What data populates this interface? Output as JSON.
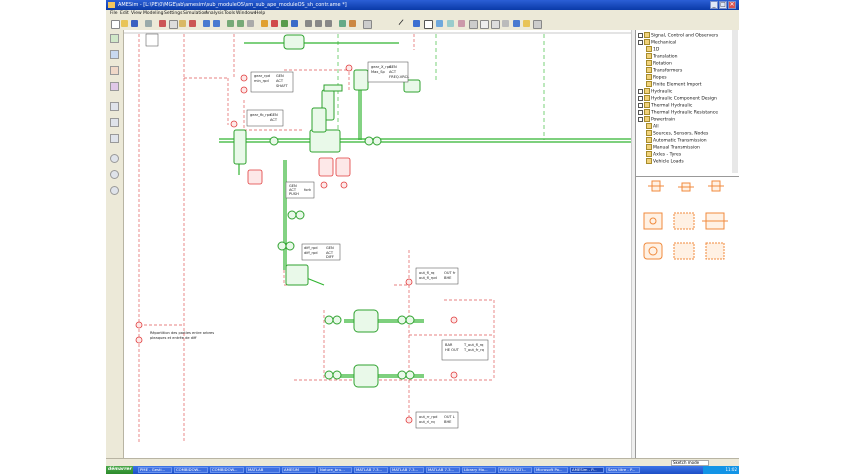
{
  "window": {
    "title": "AMESim - [L:\\PE\\0\\MGE\\ab\\amesim\\sub_moduleOS\\sm_sub_ape_moduleOS_sh_contr.ame *]",
    "controls": [
      "_",
      "□",
      "✕"
    ]
  },
  "menu": [
    "File",
    "Edit",
    "View",
    "Modeling",
    "Settings",
    "Simulation",
    "Analysis",
    "Tools",
    "Windows",
    "Help"
  ],
  "library_tree": [
    {
      "label": "Signal, Control and Observers",
      "level": 0,
      "kind": "folder"
    },
    {
      "label": "Mechanical",
      "level": 0,
      "kind": "folder"
    },
    {
      "label": "1D",
      "level": 1,
      "kind": "item"
    },
    {
      "label": "Translation",
      "level": 1,
      "kind": "item"
    },
    {
      "label": "Rotation",
      "level": 1,
      "kind": "item"
    },
    {
      "label": "Transformers",
      "level": 1,
      "kind": "item"
    },
    {
      "label": "Ropes",
      "level": 1,
      "kind": "item"
    },
    {
      "label": "Finite Element Import",
      "level": 1,
      "kind": "item"
    },
    {
      "label": "Hydraulic",
      "level": 0,
      "kind": "folder"
    },
    {
      "label": "Hydraulic Component Design",
      "level": 0,
      "kind": "folder"
    },
    {
      "label": "Thermal Hydraulic",
      "level": 0,
      "kind": "folder"
    },
    {
      "label": "Thermal Hydraulic Resistance",
      "level": 0,
      "kind": "folder"
    },
    {
      "label": "Powertrain",
      "level": 0,
      "kind": "folder"
    },
    {
      "label": "All",
      "level": 1,
      "kind": "item"
    },
    {
      "label": "Sources, Sensors, Nodes",
      "level": 1,
      "kind": "item"
    },
    {
      "label": "Automatic Transmission",
      "level": 1,
      "kind": "item"
    },
    {
      "label": "Manual Transmission",
      "level": 1,
      "kind": "item"
    },
    {
      "label": "Axles - Tyres",
      "level": 1,
      "kind": "item"
    },
    {
      "label": "Vehicle Loads",
      "level": 1,
      "kind": "item"
    }
  ],
  "diagram": {
    "labels": {
      "box1": [
        "gear_rpd",
        "min_rpd",
        "",
        "GEN",
        "ACT",
        "SHAFT"
      ],
      "box2": [
        "gear_fb_rpd",
        "",
        "GEN",
        "ACT"
      ],
      "box3": [
        "gear_X_rpd",
        "Max_Sp",
        "",
        "GEN",
        "ACT",
        "FREQ.VRCL"
      ],
      "box4": [
        "GEN",
        "ACT",
        "PUSH",
        "",
        "fork"
      ],
      "box5": [
        "diff_rpd",
        "diff_rpd",
        "",
        "GEN",
        "ACT",
        "DIFF"
      ],
      "box6": [
        "out_fl_rq",
        "out_fl_rpd",
        "",
        "OUT fr",
        "BHE"
      ],
      "box7": [
        "BAR",
        "HE OUT",
        "",
        "T_out_fl_rq",
        "T_out_fr_rq"
      ],
      "box8": [
        "out_rr_rpd",
        "out_rl_rq",
        "",
        "OUT L",
        "BHE"
      ],
      "note": [
        "Répartition des parties entre arbres",
        "pleaques et entrée de diff"
      ],
      "small_r": "R"
    }
  },
  "status": {
    "mode": "Sketch mode"
  },
  "taskbar": {
    "start": "démarrer",
    "tasks": [
      "PME - Gesti...",
      "COMBIDOW...",
      "COMBIDOW...",
      "MATLAB",
      "AMESIM",
      "Nature_bru...",
      "MATLAB 7.3...",
      "MATLAB 7.3...",
      "MATLAB 7.3...",
      "Library Mo...",
      "PRESENTATI...",
      "Microsoft Po...",
      "AMESim - P...",
      "Sans titre - P..."
    ],
    "clock": "11:02"
  },
  "colors": {
    "accent": "#0a3aa8",
    "mechanical": "#2fb52f",
    "signal": "#e03b3b",
    "palette_orange": "#f08a3c"
  }
}
